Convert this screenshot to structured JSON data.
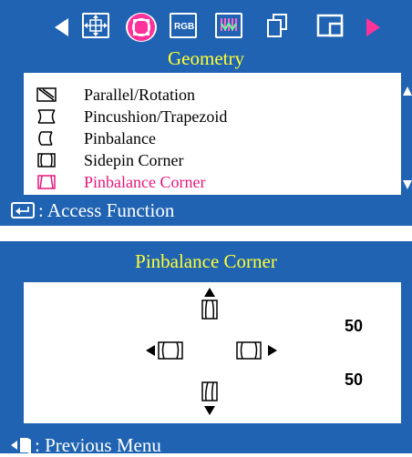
{
  "geometry_menu": {
    "title": "Geometry",
    "toolbar_icons": [
      "left-arrow-icon",
      "position-icon",
      "geometry-icon",
      "rgb-icon",
      "color-bars-icon",
      "multi-window-icon",
      "window-icon",
      "right-arrow-icon"
    ],
    "rgb_label": "RGB",
    "items": [
      {
        "label": "Parallel/Rotation",
        "icon": "parallel-rotation-icon"
      },
      {
        "label": "Pincushion/Trapezoid",
        "icon": "pincushion-trapezoid-icon"
      },
      {
        "label": "Pinbalance",
        "icon": "pinbalance-icon"
      },
      {
        "label": "Sidepin Corner",
        "icon": "sidepin-corner-icon"
      },
      {
        "label": "Pinbalance Corner",
        "icon": "pinbalance-corner-icon",
        "selected": true
      }
    ],
    "footer": ": Access Function"
  },
  "pinbalance_corner_panel": {
    "title": "Pinbalance Corner",
    "values": [
      "50",
      "50"
    ],
    "footer": ": Previous Menu"
  },
  "colors": {
    "panel_blue": "#1f63b2",
    "title_yellow": "#ffff33",
    "selected_pink": "#e8157a"
  }
}
